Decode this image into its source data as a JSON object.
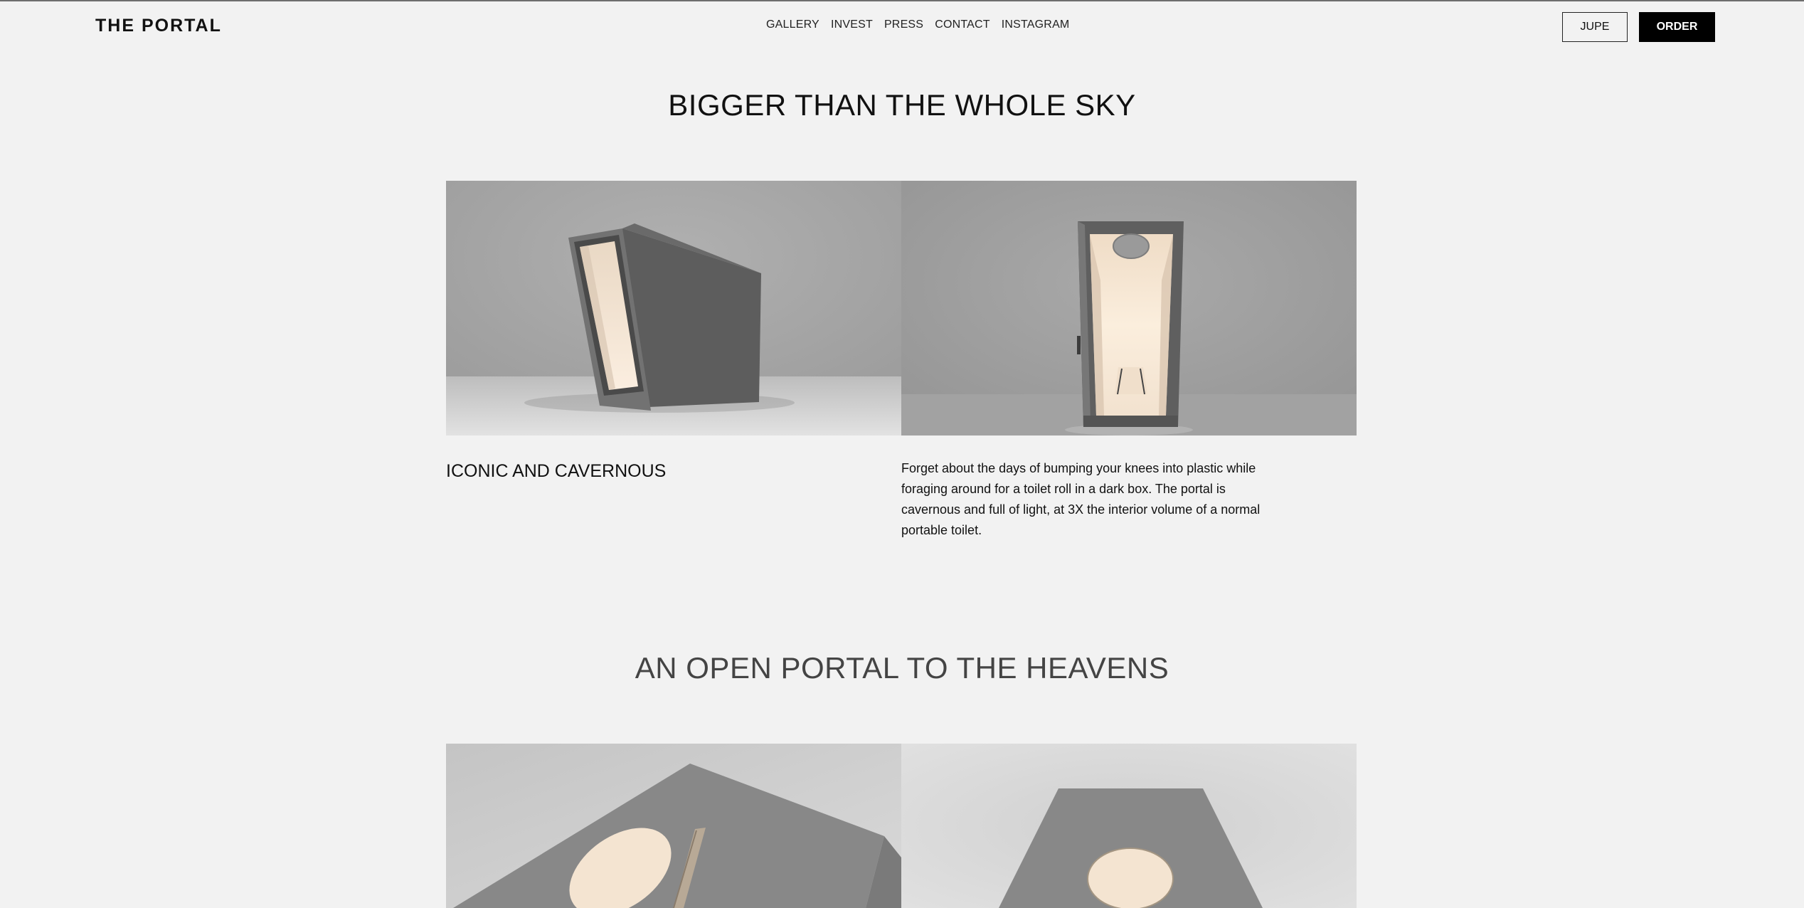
{
  "header": {
    "brand": "THE PORTAL",
    "nav": [
      "GALLERY",
      "INVEST",
      "PRESS",
      "CONTACT",
      "INSTAGRAM"
    ],
    "jupe_label": "JUPE",
    "order_label": "ORDER"
  },
  "section1": {
    "title": "BIGGER THAN THE WHOLE SKY",
    "subheading": "ICONIC AND CAVERNOUS",
    "body": "Forget about the days of bumping your knees into plastic while foraging around for a toilet roll in a dark box. The portal is cavernous and full of light, at 3X the interior volume of a normal portable toilet."
  },
  "section2": {
    "title": "AN OPEN PORTAL TO THE HEAVENS"
  },
  "colors": {
    "background": "#f2f2f2",
    "order_button": "#000000",
    "portal_body": "#606060",
    "interior_glow": "#f5e6d3"
  }
}
